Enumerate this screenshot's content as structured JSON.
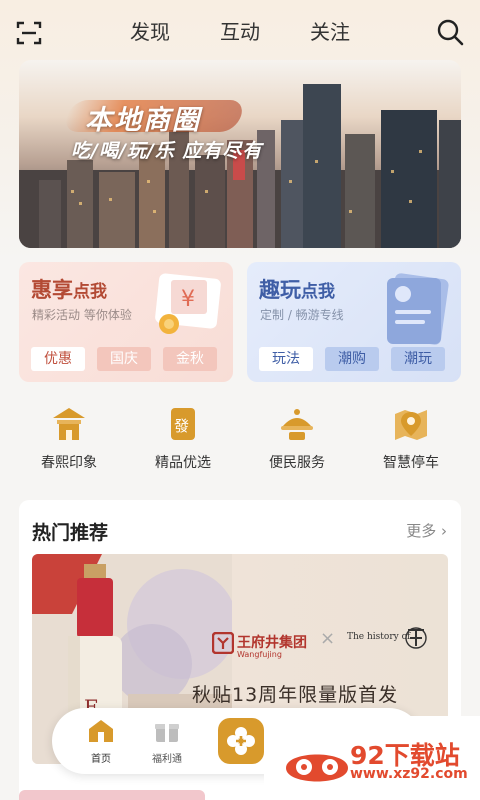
{
  "header": {
    "tabs": [
      "发现",
      "互动",
      "关注"
    ],
    "icons": [
      "scan-icon",
      "search-icon"
    ]
  },
  "banner": {
    "title": "本地商圈",
    "subtitle": "吃/喝/玩/乐 应有尽有",
    "slides": 3,
    "active_slide": 2
  },
  "cards": {
    "left": {
      "title": "惠享",
      "title_small": "点我",
      "subtitle": "精彩活动 等你体验",
      "tags": [
        "优惠",
        "国庆",
        "金秋"
      ]
    },
    "right": {
      "title": "趣玩",
      "title_small": "点我",
      "subtitle": "定制 / 畅游专线",
      "tags": [
        "玩法",
        "潮购",
        "潮玩"
      ]
    }
  },
  "services": [
    {
      "label": "春熙印象",
      "icon": "pavilion-icon"
    },
    {
      "label": "精品优选",
      "icon": "fa-badge-icon"
    },
    {
      "label": "便民服务",
      "icon": "service-bell-icon"
    },
    {
      "label": "智慧停车",
      "icon": "map-pin-icon"
    }
  ],
  "hot": {
    "title": "热门推荐",
    "more": "更多",
    "promo": {
      "brand": "王府井集团",
      "brand_en": "Wangfujing",
      "partner": "The history of",
      "headline": "秋贴13周年限量版首发"
    }
  },
  "dock": {
    "items": [
      {
        "label": "首页",
        "icon": "home-icon",
        "active": true
      },
      {
        "label": "福利通",
        "icon": "gift-icon",
        "active": false
      }
    ],
    "center_icon": "plus-icon"
  },
  "watermark": {
    "text": "92下载站",
    "url": "www.xz92.com"
  },
  "colors": {
    "accent": "#d89a2c",
    "left_card": "#b34a34",
    "right_card": "#3f5ea6",
    "watermark": "#e24a2e"
  }
}
